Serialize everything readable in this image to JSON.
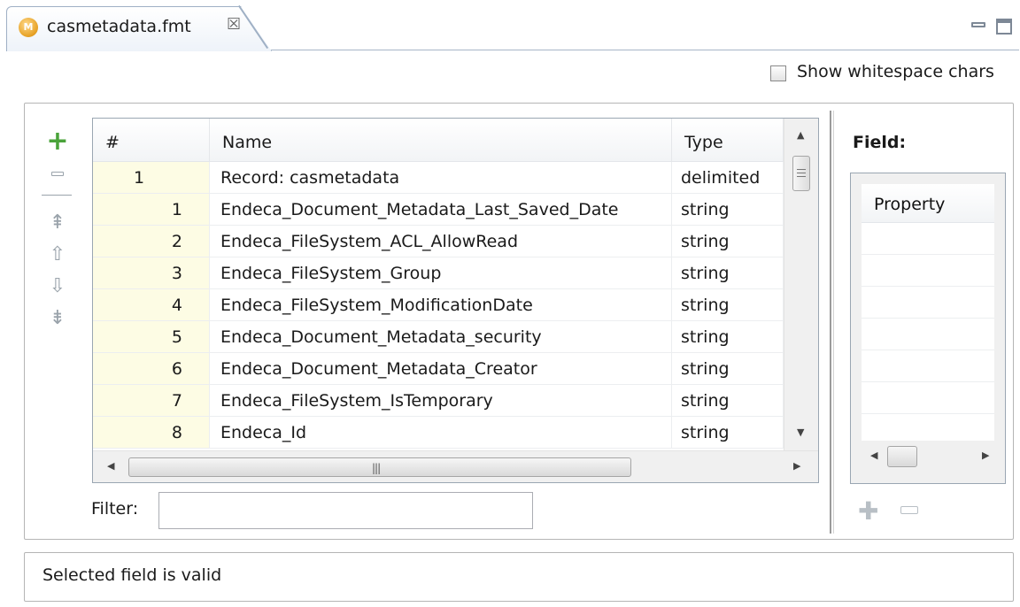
{
  "tab": {
    "title": "casmetadata.fmt",
    "icon": "format-file-icon",
    "close_glyph": "☒"
  },
  "options": {
    "show_whitespace_label": "Show whitespace chars",
    "show_whitespace_checked": false
  },
  "toolbar": {
    "add": "add-icon",
    "remove": "remove-icon",
    "move_top": "move-top-icon",
    "move_up": "move-up-icon",
    "move_down": "move-down-icon",
    "move_bottom": "move-bottom-icon"
  },
  "table": {
    "headers": {
      "num": "#",
      "name": "Name",
      "type": "Type"
    },
    "rows": [
      {
        "num": "1",
        "name": "Record: casmetadata",
        "type": "delimited",
        "kind": "record"
      },
      {
        "num": "1",
        "name": "Endeca_Document_Metadata_Last_Saved_Date",
        "type": "string",
        "kind": "field"
      },
      {
        "num": "2",
        "name": "Endeca_FileSystem_ACL_AllowRead",
        "type": "string",
        "kind": "field"
      },
      {
        "num": "3",
        "name": "Endeca_FileSystem_Group",
        "type": "string",
        "kind": "field"
      },
      {
        "num": "4",
        "name": "Endeca_FileSystem_ModificationDate",
        "type": "string",
        "kind": "field"
      },
      {
        "num": "5",
        "name": "Endeca_Document_Metadata_security",
        "type": "string",
        "kind": "field"
      },
      {
        "num": "6",
        "name": "Endeca_Document_Metadata_Creator",
        "type": "string",
        "kind": "field"
      },
      {
        "num": "7",
        "name": "Endeca_FileSystem_IsTemporary",
        "type": "string",
        "kind": "field"
      },
      {
        "num": "8",
        "name": "Endeca_Id",
        "type": "string",
        "kind": "field"
      }
    ]
  },
  "filter": {
    "label": "Filter:",
    "value": ""
  },
  "field_panel": {
    "label": "Field:",
    "property_header": "Property"
  },
  "status": {
    "message": "Selected field is valid"
  }
}
